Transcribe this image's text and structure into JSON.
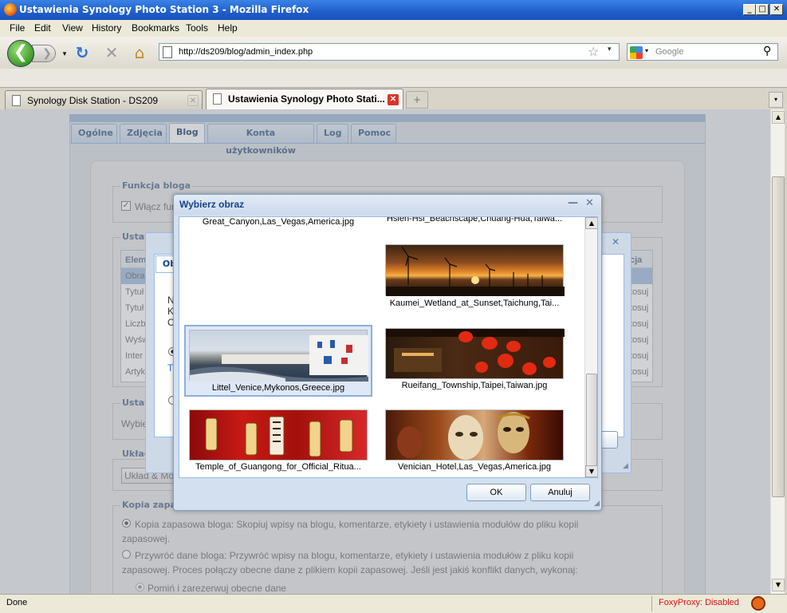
{
  "window": {
    "title": "Ustawienia Synology Photo Station 3 - Mozilla Firefox",
    "controls": {
      "minimize": "_",
      "maximize": "□",
      "close": "✕"
    }
  },
  "menu": [
    "File",
    "Edit",
    "View",
    "History",
    "Bookmarks",
    "Tools",
    "Help"
  ],
  "nav": {
    "back_icon": "back-arrow-icon",
    "url": "http://ds209/blog/admin_index.php",
    "search_placeholder": "Google",
    "reload_glyph": "↻",
    "stop_glyph": "✕",
    "home_glyph": "⌂",
    "back_glyph": "❮",
    "fwd_glyph": "❯",
    "star_glyph": "☆",
    "dropdown_glyph": "▾",
    "search_glyph": "⚲"
  },
  "tabs": [
    {
      "label": "Synology Disk Station - DS209"
    },
    {
      "label": "Ustawienia Synology Photo Stati..."
    }
  ],
  "tab_close_glyph": "✕",
  "newtab_glyph": "+",
  "status": {
    "text": "Done",
    "foxyproxy": "FoxyProxy: Disabled"
  },
  "page": {
    "tabs": [
      "Ogólne",
      "Zdjęcia",
      "Blog",
      "Konta użytkowników",
      "Log",
      "Pomoc"
    ],
    "sections": {
      "blog_function": {
        "legend": "Funkcja bloga",
        "checkbox": "Włącz fun"
      },
      "settings": {
        "legend": "Ustawie",
        "header": "Elem",
        "rows": [
          "Obra",
          "Tytuł",
          "Tytuł",
          "Liczb",
          "Wyśw",
          "Inter",
          "Artyk"
        ],
        "right_header": "cja",
        "right_rows": [
          "tosuj",
          "tosuj",
          "tosuj",
          "tosuj",
          "tosuj",
          "tosuj"
        ]
      },
      "usta2": {
        "legend": "Ustaw",
        "text": "Wybie"
      },
      "layout": {
        "legend": "Układ & Mo",
        "button": "Układ & Mo"
      },
      "backup": {
        "legend": "Kopia zapasowa",
        "opt1": "Kopia zapasowa bloga: Skopiuj wpisy na blogu, komentarze, etykiety i ustawienia modułów do pliku kopii zapasowej.",
        "opt2": "Przywróć dane bloga: Przywróć wpisy na blogu, komentarze, etykiety i ustawienia modułów z pliku kopii zapasowej. Proces połączy obecne dane z plikiem kopii zapasowej. Jeśli jest jakiś konflikt danych, wykonaj:",
        "sub1": "Pomiń i zarezerwuj obecne dane"
      }
    },
    "bg_dialog": {
      "tab": "Ob",
      "lines": [
        "N",
        "K",
        "C"
      ],
      "link": "T"
    }
  },
  "chooser": {
    "title": "Wybierz obraz",
    "tools": {
      "minimize": "—",
      "close": "✕"
    },
    "items": [
      {
        "caption": "Great_Canyon,Las_Vegas,America.jpg",
        "image": "canyon-partial"
      },
      {
        "caption": "Hsien-Hsi_Beachscape,Chuang-Hua,Taiwa...",
        "image": "beach-partial"
      },
      {
        "caption": "Kaumei_Wetland_at_Sunset,Taichung,Tai...",
        "image": "wind-turbines-sunset"
      },
      {
        "caption": "Littel_Venice,Mykonos,Greece.jpg",
        "image": "mykonos-waterfront",
        "selected": true
      },
      {
        "caption": "Rueifang_Township,Taipei,Taiwan.jpg",
        "image": "red-lanterns"
      },
      {
        "caption": "Temple_of_Guangong_for_Official_Ritua...",
        "image": "temple-lanterns"
      },
      {
        "caption": "Venician_Hotel,Las_Vegas,America.jpg",
        "image": "venetian-masks"
      }
    ],
    "ok": "OK",
    "cancel": "Anuluj"
  }
}
